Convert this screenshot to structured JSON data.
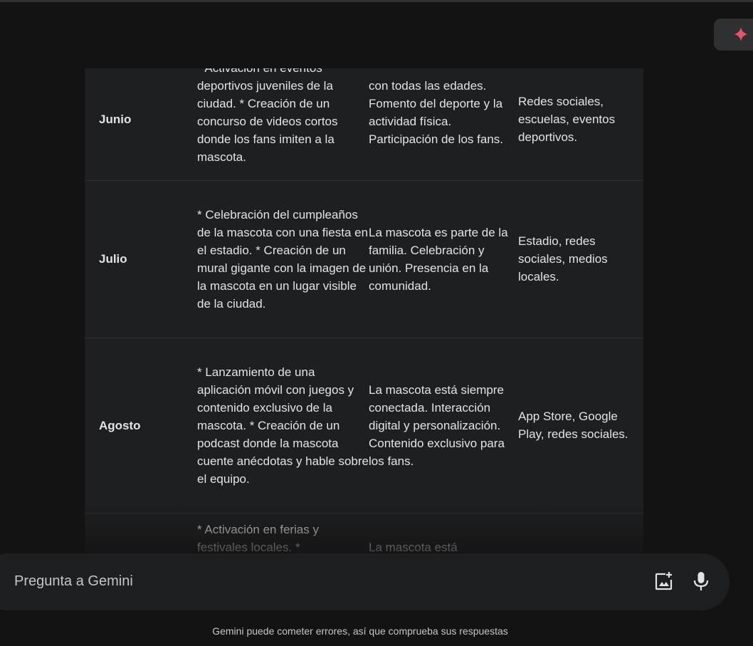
{
  "input": {
    "placeholder": "Pregunta a Gemini"
  },
  "disclaimer": "Gemini puede cometer errores, así que comprueba sus respuestas",
  "icons": {
    "spark": "gemini-spark-icon",
    "image": "add-image-icon",
    "mic": "microphone-icon"
  },
  "colors": {
    "spark": "#e8546a",
    "background": "#131314",
    "table_bg": "#1e1f20"
  },
  "table": {
    "rows": [
      {
        "month": "Junio",
        "actions": "* Activación en eventos deportivos juveniles de la ciudad. * Creación de un concurso de videos cortos donde los fans imiten a la mascota.",
        "message": "con todas las edades. Fomento del deporte y la actividad física. Participación de los fans.",
        "channels": "Redes sociales, escuelas, eventos deportivos."
      },
      {
        "month": "Julio",
        "actions": "* Celebración del cumpleaños de la mascota con una fiesta en el estadio. * Creación de un mural gigante con la imagen de la mascota en un lugar visible de la ciudad.",
        "message": "La mascota es parte de la familia. Celebración y unión. Presencia en la comunidad.",
        "channels": "Estadio, redes sociales, medios locales."
      },
      {
        "month": "Agosto",
        "actions": "* Lanzamiento de una aplicación móvil con juegos y contenido exclusivo de la mascota. * Creación de un podcast donde la mascota cuente anécdotas y hable sobre el equipo.",
        "message": "La mascota está siempre conectada. Interacción digital y personalización. Contenido exclusivo para los fans.",
        "channels": "App Store, Google Play, redes sociales."
      },
      {
        "month": "",
        "actions": "* Activación en ferias y festivales locales. *",
        "message": "La mascota está",
        "channels": ""
      }
    ]
  }
}
